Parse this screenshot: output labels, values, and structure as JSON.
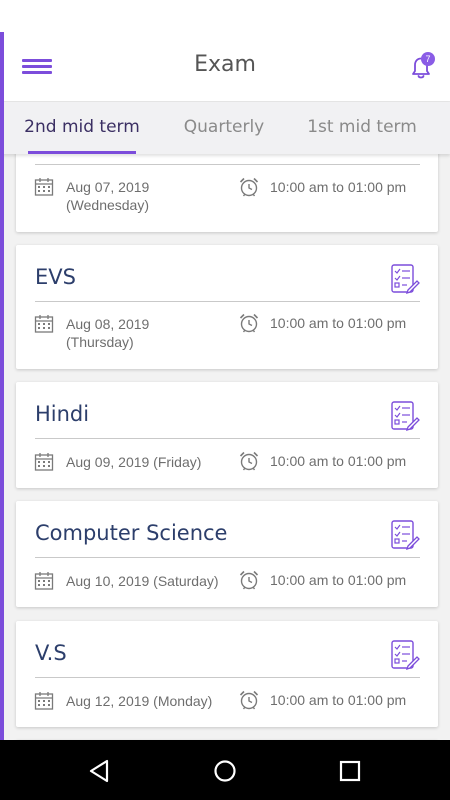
{
  "app": {
    "title": "Exam",
    "accent_color": "#7c4ddb",
    "notification_count": "7"
  },
  "tabs": [
    {
      "label": "2nd mid term",
      "active": true
    },
    {
      "label": "Quarterly",
      "active": false
    },
    {
      "label": "1st mid term",
      "active": false
    }
  ],
  "exams": [
    {
      "subject": "",
      "date": "Aug 07, 2019",
      "day": "(Wednesday)",
      "time": "10:00 am to 01:00 pm"
    },
    {
      "subject": "EVS",
      "date": "Aug 08, 2019",
      "day": "(Thursday)",
      "time": "10:00 am to 01:00 pm"
    },
    {
      "subject": "Hindi",
      "date": "Aug 09, 2019 (Friday)",
      "day": "",
      "time": "10:00 am to 01:00 pm"
    },
    {
      "subject": "Computer Science",
      "date": "Aug 10, 2019 (Saturday)",
      "day": "",
      "time": "10:00 am to 01:00 pm"
    },
    {
      "subject": "V.S",
      "date": "Aug 12, 2019 (Monday)",
      "day": "",
      "time": "10:00 am to 01:00 pm"
    }
  ],
  "icons": {
    "menu": "hamburger-menu-icon",
    "notifications": "bell-icon",
    "exam_paper": "exam-paper-icon",
    "date": "calendar-icon",
    "time": "alarm-clock-icon",
    "nav_back": "back-triangle-icon",
    "nav_home": "home-circle-icon",
    "nav_recents": "recents-square-icon"
  }
}
